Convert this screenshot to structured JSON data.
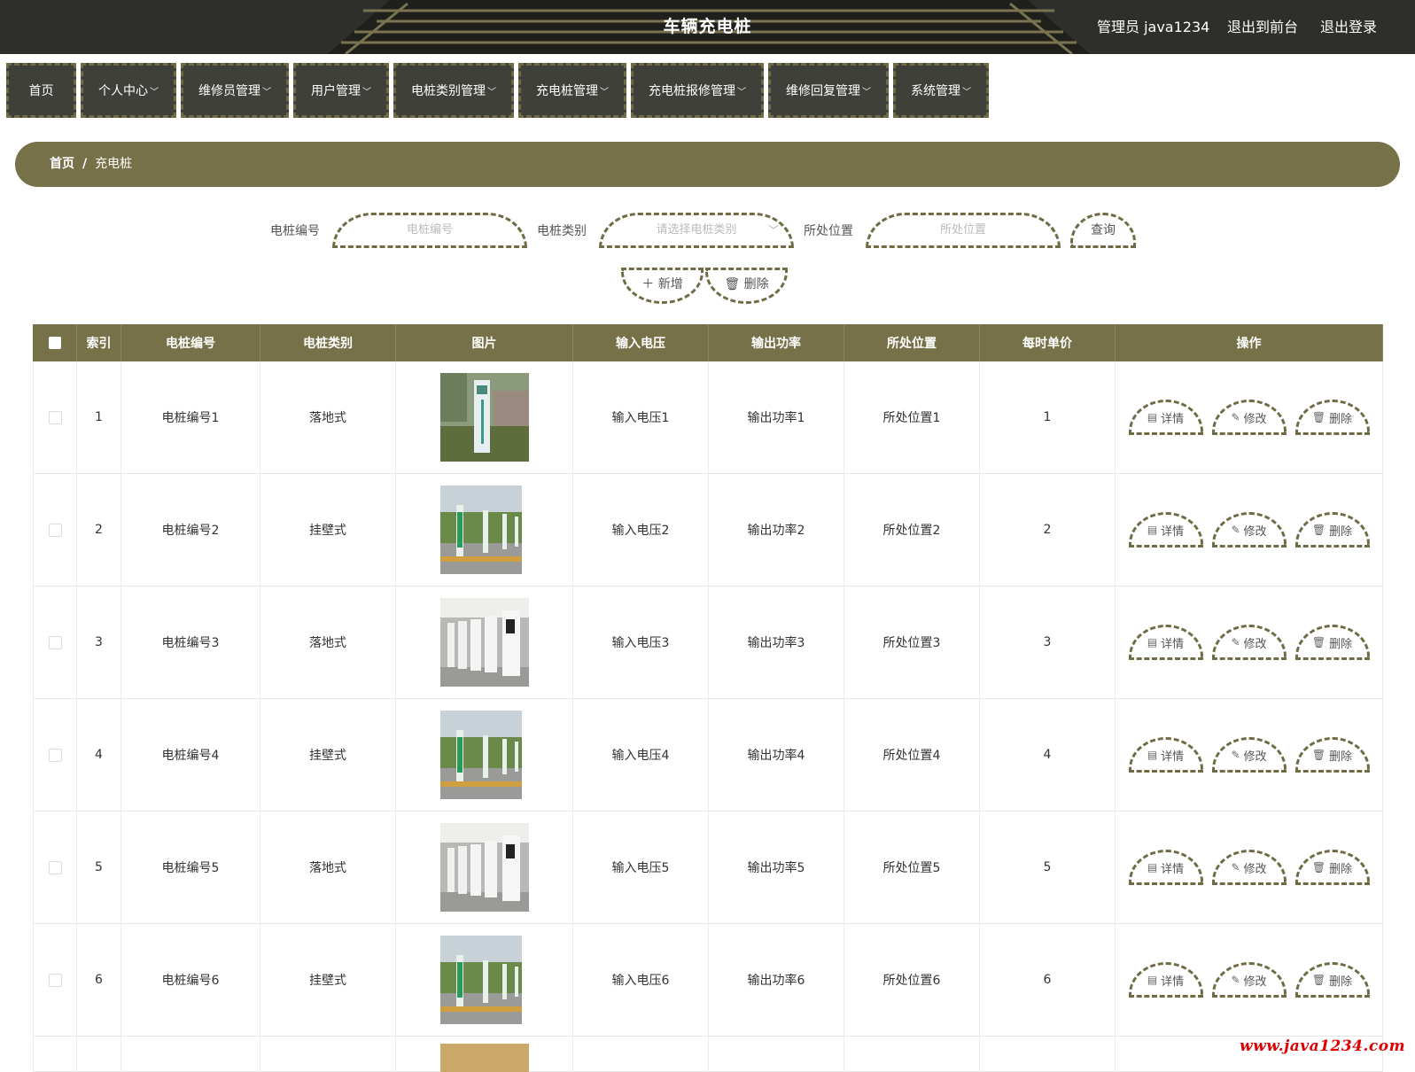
{
  "header": {
    "title": "车辆充电桩",
    "admin_label": "管理员 java1234",
    "back_front": "退出到前台",
    "logout": "退出登录"
  },
  "nav": {
    "items": [
      {
        "label": "首页",
        "has_menu": false
      },
      {
        "label": "个人中心",
        "has_menu": true
      },
      {
        "label": "维修员管理",
        "has_menu": true
      },
      {
        "label": "用户管理",
        "has_menu": true
      },
      {
        "label": "电桩类别管理",
        "has_menu": true
      },
      {
        "label": "充电桩管理",
        "has_menu": true
      },
      {
        "label": "充电桩报修管理",
        "has_menu": true
      },
      {
        "label": "维修回复管理",
        "has_menu": true
      },
      {
        "label": "系统管理",
        "has_menu": true
      }
    ]
  },
  "breadcrumb": {
    "home": "首页",
    "separator": "/",
    "current": "充电桩"
  },
  "search": {
    "code_label": "电桩编号",
    "code_placeholder": "电桩编号",
    "type_label": "电桩类别",
    "type_placeholder": "请选择电桩类别",
    "location_label": "所处位置",
    "location_placeholder": "所处位置",
    "query_button": "查询",
    "add_button": "新增",
    "delete_button": "删除"
  },
  "table": {
    "headers": [
      "索引",
      "电桩编号",
      "电桩类别",
      "图片",
      "输入电压",
      "输出功率",
      "所处位置",
      "每时单价",
      "操作"
    ],
    "actions": {
      "detail": "详情",
      "edit": "修改",
      "delete": "删除"
    },
    "rows": [
      {
        "index": "1",
        "code": "电桩编号1",
        "type": "落地式",
        "image": "pile-standing",
        "voltage": "输入电压1",
        "power": "输出功率1",
        "location": "所处位置1",
        "price": "1"
      },
      {
        "index": "2",
        "code": "电桩编号2",
        "type": "挂壁式",
        "image": "pile-wall",
        "voltage": "输入电压2",
        "power": "输出功率2",
        "location": "所处位置2",
        "price": "2"
      },
      {
        "index": "3",
        "code": "电桩编号3",
        "type": "落地式",
        "image": "pile-row",
        "voltage": "输入电压3",
        "power": "输出功率3",
        "location": "所处位置3",
        "price": "3"
      },
      {
        "index": "4",
        "code": "电桩编号4",
        "type": "挂壁式",
        "image": "pile-wall",
        "voltage": "输入电压4",
        "power": "输出功率4",
        "location": "所处位置4",
        "price": "4"
      },
      {
        "index": "5",
        "code": "电桩编号5",
        "type": "落地式",
        "image": "pile-row",
        "voltage": "输入电压5",
        "power": "输出功率5",
        "location": "所处位置5",
        "price": "5"
      },
      {
        "index": "6",
        "code": "电桩编号6",
        "type": "挂壁式",
        "image": "pile-wall",
        "voltage": "输入电压6",
        "power": "输出功率6",
        "location": "所处位置6",
        "price": "6"
      }
    ]
  },
  "watermark": "www.java1234.com",
  "colors": {
    "accent": "#767149",
    "header_bg": "#2e2f2a",
    "nav_bg": "#3f403a",
    "dash": "#6f6c45"
  }
}
